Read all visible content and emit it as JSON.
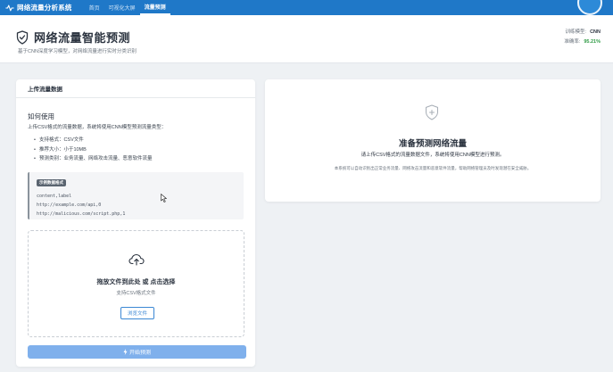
{
  "app": {
    "title": "网络流量分析系统"
  },
  "nav": {
    "items": [
      {
        "label": "首页"
      },
      {
        "label": "可视化大屏"
      },
      {
        "label": "流量预测"
      }
    ],
    "active_index": 2
  },
  "header": {
    "title": "网络流量智能预测",
    "subtitle": "基于CNN深度学习模型，对网络流量进行实时分类识别",
    "model_label": "训练模型:",
    "model_value": "CNN",
    "accuracy_label": "准确率:",
    "accuracy_value": "95.21%"
  },
  "upload_panel": {
    "header": "上传流量数据",
    "howto_title": "如何使用",
    "howto_desc": "上传CSV格式的流量数据，系统将使用CNN模型预测流量类型：",
    "specs": [
      "支持格式：CSV文件",
      "推荐大小：小于10MB",
      "预测类别：业务流量、网络攻击流量、恶意软件流量"
    ],
    "example_badge": "示例数据格式",
    "example_lines": [
      "content,label",
      "http://example.com/api,0",
      "http://malicious.com/script.php,1"
    ],
    "drop_title": "拖放文件到此处 或 点击选择",
    "drop_sub": "支持CSV格式文件",
    "browse_label": "浏览文件",
    "predict_label": "开始预测"
  },
  "result_panel": {
    "title": "准备预测网络流量",
    "desc": "请上传CSV格式的流量数据文件，系统将使用CNN模型进行预测。",
    "note": "本系统可以自动识别出正常业务流量、网络攻击流量和恶意软件流量，帮助网络管理员及时发现潜在安全威胁。"
  },
  "colors": {
    "nav_bg": "#1f78c8",
    "accent": "#3b87d4",
    "predict_button": "#7fb0ec",
    "accuracy": "#2e9a44"
  },
  "icons": [
    "activity-icon",
    "shield-icon",
    "upload-cloud-icon",
    "bolt-icon",
    "shield-plus-icon",
    "mouse-cursor-icon"
  ]
}
